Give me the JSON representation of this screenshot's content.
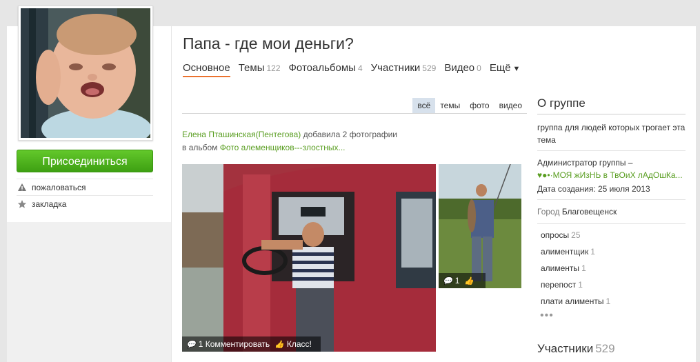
{
  "group": {
    "title": "Папа - где мои деньги?",
    "join_label": "Присоединиться",
    "report_label": "пожаловаться",
    "bookmark_label": "закладка"
  },
  "tabs": [
    {
      "label": "Основное",
      "count": ""
    },
    {
      "label": "Темы",
      "count": "122"
    },
    {
      "label": "Фотоальбомы",
      "count": "4"
    },
    {
      "label": "Участники",
      "count": "529"
    },
    {
      "label": "Видео",
      "count": "0"
    },
    {
      "label": "Ещё",
      "count": ""
    }
  ],
  "filters": [
    "всё",
    "темы",
    "фото",
    "видео"
  ],
  "feed": {
    "author": "Елена Пташинская(Пентегова)",
    "action": "добавила 2 фотографии",
    "album_prefix": "в альбом",
    "album": "Фото алеменщиков---злостных...",
    "photo1_comments": "1 Комментировать",
    "photo1_like": "Класс!",
    "photo2_comments": "1"
  },
  "about": {
    "title": "О группе",
    "description": "группа для людей которых трогает эта тема",
    "admin_label": "Администратор группы –",
    "admin_name": "♥●•·МОЯ жИзНЬ в ТвОиХ лАдОшКа...",
    "created": "Дата создания: 25 июля 2013",
    "city_label": "Город",
    "city": "Благовещенск"
  },
  "tags": [
    {
      "name": "опросы",
      "count": "25"
    },
    {
      "name": "алиментщик",
      "count": "1"
    },
    {
      "name": "алименты",
      "count": "1"
    },
    {
      "name": "перепост",
      "count": "1"
    },
    {
      "name": "плати алименты",
      "count": "1"
    }
  ],
  "more_dots": "•••",
  "members": {
    "label": "Участники",
    "count": "529"
  },
  "colors": {
    "accent": "#eb722e",
    "green": "#5a9e22",
    "join": "#4cb31c"
  }
}
